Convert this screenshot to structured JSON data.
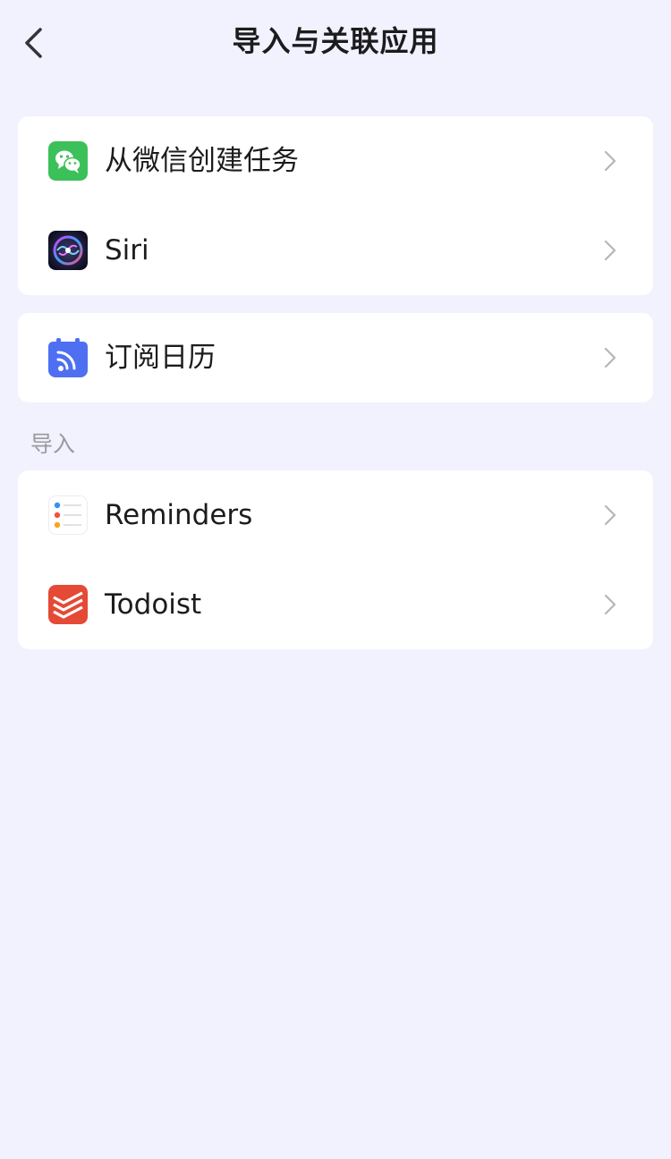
{
  "header": {
    "title": "导入与关联应用",
    "back_icon": "chevron-left-icon"
  },
  "groups": [
    {
      "items": [
        {
          "label": "从微信创建任务",
          "icon": "wechat-icon",
          "icon_color": "#3cc05a"
        },
        {
          "label": "Siri",
          "icon": "siri-icon",
          "icon_color": "#1a1a3a"
        }
      ]
    },
    {
      "items": [
        {
          "label": "订阅日历",
          "icon": "calendar-feed-icon",
          "icon_color": "#4e6ff2"
        }
      ]
    }
  ],
  "import_section": {
    "title": "导入",
    "items": [
      {
        "label": "Reminders",
        "icon": "reminders-icon"
      },
      {
        "label": "Todoist",
        "icon": "todoist-icon",
        "icon_color": "#e44a36"
      }
    ]
  },
  "colors": {
    "background": "#f1f2fd",
    "card": "#ffffff",
    "section_title": "#9a9aa2",
    "chevron": "#b5b5bb"
  }
}
